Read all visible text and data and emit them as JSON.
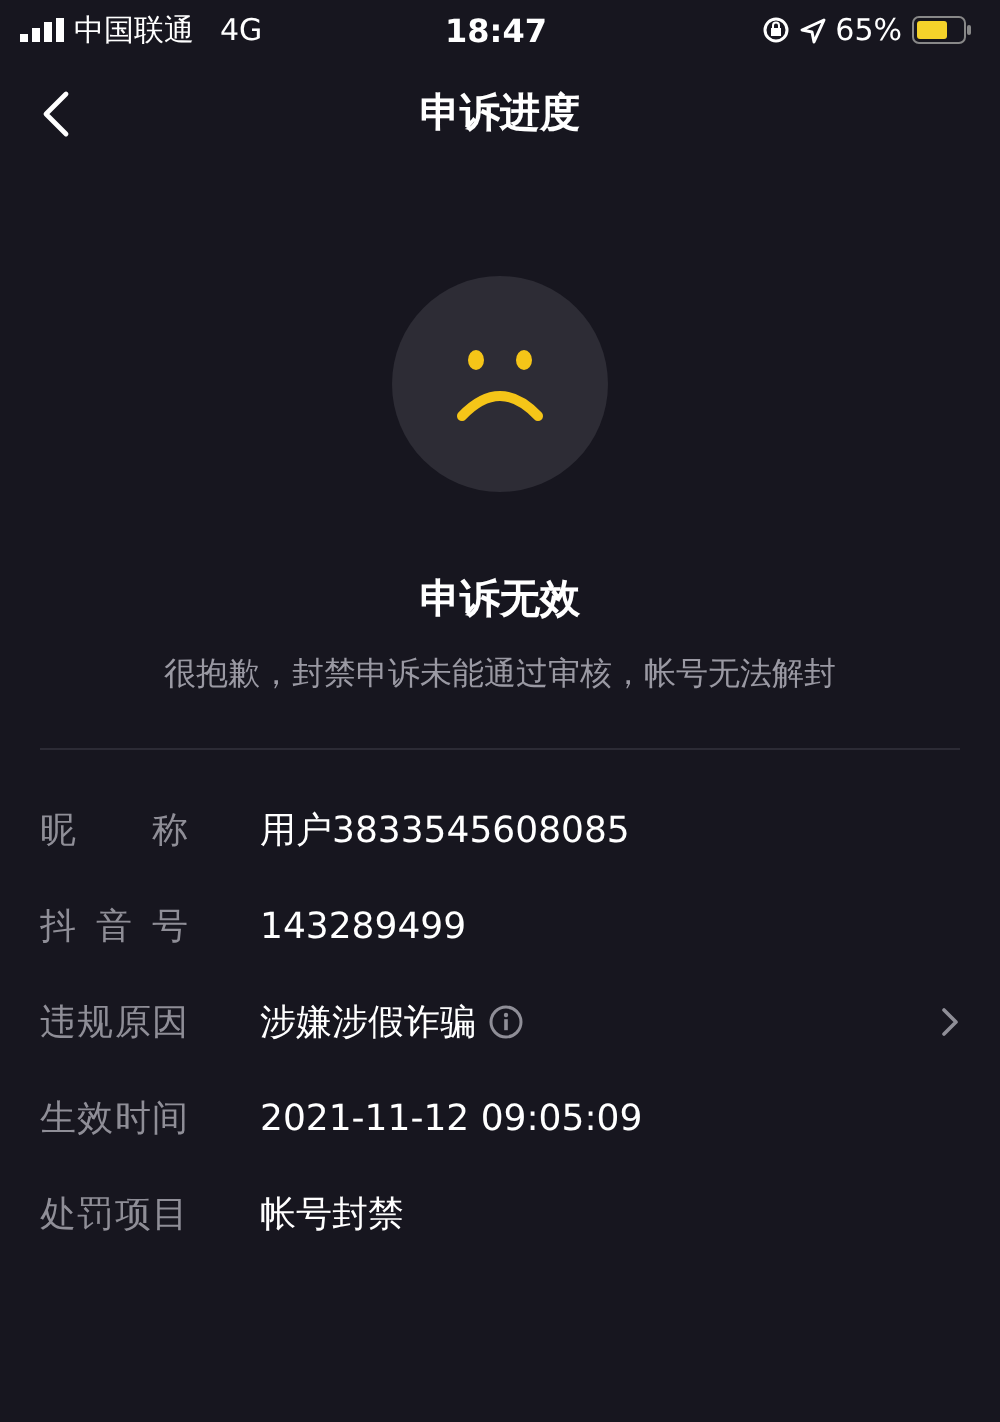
{
  "status_bar": {
    "carrier": "中国联通",
    "network": "4G",
    "time": "18:47",
    "battery_percent": "65%"
  },
  "nav": {
    "title": "申诉进度"
  },
  "result": {
    "title": "申诉无效",
    "message": "很抱歉，封禁申诉未能通过审核，帐号无法解封"
  },
  "details": [
    {
      "label": "昵称",
      "value": "用户3833545608085",
      "info": false,
      "arrow": false
    },
    {
      "label": "抖音号",
      "value": "143289499",
      "info": false,
      "arrow": false
    },
    {
      "label": "违规原因",
      "value": "涉嫌涉假诈骗",
      "info": true,
      "arrow": true
    },
    {
      "label": "生效时间",
      "value": "2021-11-12 09:05:09",
      "info": false,
      "arrow": false
    },
    {
      "label": "处罚项目",
      "value": "帐号封禁",
      "info": false,
      "arrow": false
    }
  ]
}
